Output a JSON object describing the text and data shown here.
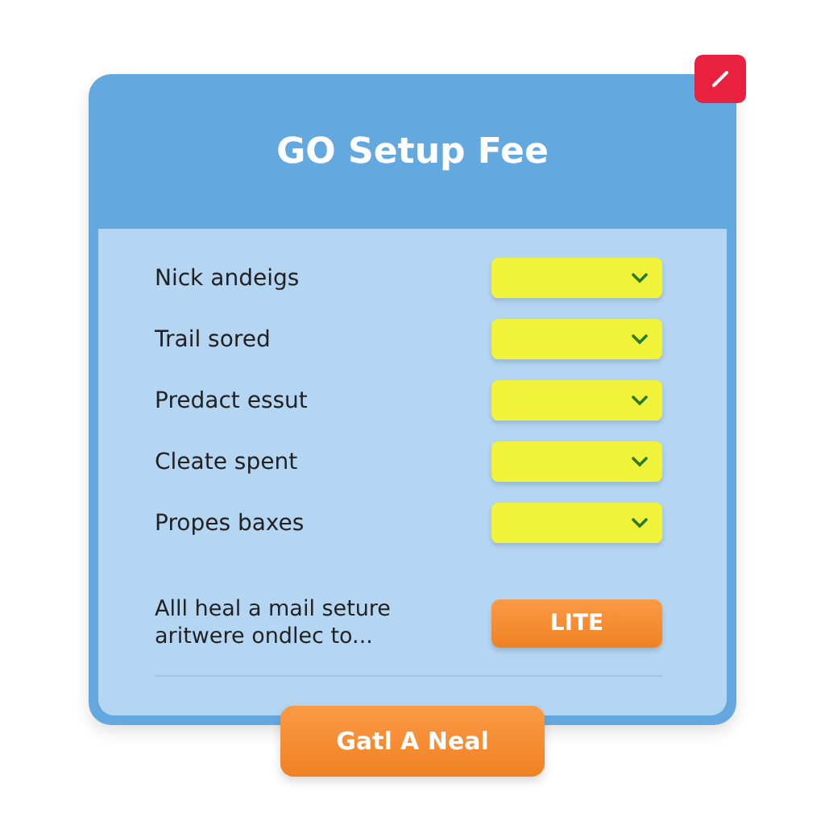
{
  "dialog": {
    "title": "GO Setup Fee"
  },
  "rows": [
    {
      "label": "Nick andeigs"
    },
    {
      "label": "Trail sored"
    },
    {
      "label": "Predact essut"
    },
    {
      "label": "Cleate spent"
    },
    {
      "label": "Propes baxes"
    }
  ],
  "description": "Alll heal a mail seture aritwere ondlec to...",
  "option_button": "LITE",
  "primary_button": "Gatl A Neal"
}
